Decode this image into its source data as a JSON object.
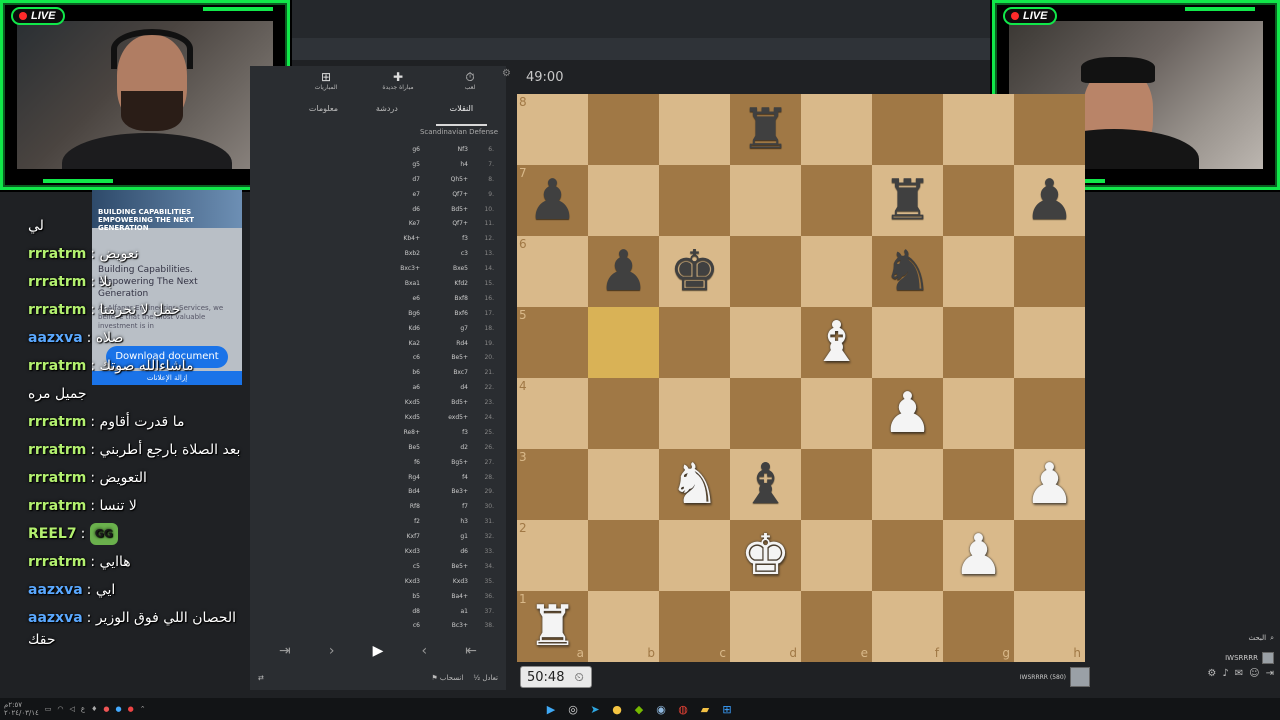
{
  "overlay": {
    "live_label": "LIVE",
    "colors": {
      "frame": "#11e84a",
      "live_dot": "#ff2b2b"
    }
  },
  "chat": [
    {
      "user": "",
      "message": "لي",
      "color": "#ffffff"
    },
    {
      "user": "rrratrm",
      "message": "نعويض",
      "color": "#b3f06f"
    },
    {
      "user": "rrratrm",
      "message": "بلا",
      "color": "#b3f06f"
    },
    {
      "user": "rrratrm",
      "message": "خمل لا نحرمنا",
      "color": "#b3f06f"
    },
    {
      "user": "aazxva",
      "message": "صلاه",
      "color": "#5aa8ff"
    },
    {
      "user": "rrratrm",
      "message": "ماشاءالله صوتك",
      "color": "#b3f06f"
    },
    {
      "user": "",
      "message": "جميل مره",
      "color": "#ffffff"
    },
    {
      "user": "rrratrm",
      "message": "ما قدرت أقاوم",
      "color": "#b3f06f"
    },
    {
      "user": "rrratrm",
      "message": "بعد الصلاة بارجع أطربني",
      "color": "#b3f06f",
      "wrap": true
    },
    {
      "user": "rrratrm",
      "message": "التعويض",
      "color": "#b3f06f"
    },
    {
      "user": "rrratrm",
      "message": "لا تنسا",
      "color": "#b3f06f"
    },
    {
      "user": "REEL7",
      "message": "",
      "emote": "GG",
      "color": "#b3f06f"
    },
    {
      "user": "rrratrm",
      "message": "هاايي",
      "color": "#b3f06f"
    },
    {
      "user": "aazxva",
      "message": "ايي",
      "color": "#5aa8ff"
    },
    {
      "user": "aazxva",
      "message": "الحصان اللي فوق الوزير حقك",
      "color": "#5aa8ff",
      "wrap": true
    }
  ],
  "ad": {
    "banner": "BUILDING CAPABILITIES EMPOWERING THE NEXT GENERATION",
    "title": "Building Capabilities. Empowering The Next Generation",
    "body": "At Alfanar Engineering Services, we believe that the most valuable investment is in",
    "button": "Download document",
    "footer": "إزالة الإعلانات"
  },
  "panel": {
    "tabs": [
      {
        "icon": "⏱",
        "label": "لعب"
      },
      {
        "icon": "✚",
        "label": "مباراة جديدة"
      },
      {
        "icon": "⊞",
        "label": "المباريات"
      }
    ],
    "subtabs": [
      "النقلات",
      "دردشة",
      "معلومات"
    ],
    "opening": "Scandinavian Defense",
    "moves": [
      {
        "n": "6.",
        "w": "Nf3",
        "b": "g6",
        "t": ""
      },
      {
        "n": "7.",
        "w": "h4",
        "b": "g5",
        "t": ""
      },
      {
        "n": "8.",
        "w": "Qh5+",
        "b": "d7",
        "t": ""
      },
      {
        "n": "9.",
        "w": "Qf7+",
        "b": "e7",
        "t": ""
      },
      {
        "n": "10.",
        "w": "Bd5+",
        "b": "d6",
        "t": ""
      },
      {
        "n": "11.",
        "w": "Qf7+",
        "b": "Ke7",
        "t": ""
      },
      {
        "n": "12.",
        "w": "f3",
        "b": "Kb4+",
        "t": ""
      },
      {
        "n": "13.",
        "w": "c3",
        "b": "Bxb2",
        "t": ""
      },
      {
        "n": "14.",
        "w": "Bxe5",
        "b": "Bxc3+",
        "t": ""
      },
      {
        "n": "15.",
        "w": "Kfd2",
        "b": "Bxa1",
        "t": ""
      },
      {
        "n": "16.",
        "w": "Bxf8",
        "b": "e6",
        "t": ""
      },
      {
        "n": "17.",
        "w": "Bxf6",
        "b": "Bg6",
        "t": ""
      },
      {
        "n": "18.",
        "w": "g7",
        "b": "Kd6",
        "t": ""
      },
      {
        "n": "19.",
        "w": "Rd4",
        "b": "Ka2",
        "t": ""
      },
      {
        "n": "20.",
        "w": "Be5+",
        "b": "c6",
        "t": ""
      },
      {
        "n": "21.",
        "w": "Bxc7",
        "b": "b6",
        "t": ""
      },
      {
        "n": "22.",
        "w": "d4",
        "b": "a6",
        "t": ""
      },
      {
        "n": "23.",
        "w": "Bd5+",
        "b": "Kxd5",
        "t": ""
      },
      {
        "n": "24.",
        "w": "exd5+",
        "b": "Kxd5",
        "t": ""
      },
      {
        "n": "25.",
        "w": "f3",
        "b": "Re8+",
        "t": ""
      },
      {
        "n": "26.",
        "w": "d2",
        "b": "Be5",
        "t": ""
      },
      {
        "n": "27.",
        "w": "Bg5+",
        "b": "f6",
        "t": ""
      },
      {
        "n": "28.",
        "w": "f4",
        "b": "Rg4",
        "t": ""
      },
      {
        "n": "29.",
        "w": "Be3+",
        "b": "Bd4",
        "t": ""
      },
      {
        "n": "30.",
        "w": "f7",
        "b": "Rf8",
        "t": ""
      },
      {
        "n": "31.",
        "w": "h3",
        "b": "f2",
        "t": ""
      },
      {
        "n": "32.",
        "w": "g1",
        "b": "Kxf7",
        "t": ""
      },
      {
        "n": "33.",
        "w": "d6",
        "b": "Kxd3",
        "t": ""
      },
      {
        "n": "34.",
        "w": "Be5+",
        "b": "c5",
        "t": ""
      },
      {
        "n": "35.",
        "w": "Kxd3",
        "b": "Kxd3",
        "t": ""
      },
      {
        "n": "36.",
        "w": "Ba4+",
        "b": "b5",
        "t": ""
      },
      {
        "n": "37.",
        "w": "a1",
        "b": "d8",
        "t": ""
      },
      {
        "n": "38.",
        "w": "Bc3+",
        "b": "c6",
        "t": ""
      }
    ],
    "draw_label": "½ تعادل",
    "resign_label": "انسحاب"
  },
  "board": {
    "timer_top": "49:00",
    "timer_bottom": "50:48",
    "ranks": [
      "8",
      "7",
      "6",
      "5",
      "4",
      "3",
      "2",
      "1"
    ],
    "files": [
      "a",
      "b",
      "c",
      "d",
      "e",
      "f",
      "g",
      "h"
    ],
    "pieces": {
      "d8": "bR",
      "a7": "bP",
      "f7": "bR",
      "h7": "bP",
      "b6": "bP",
      "c6": "bK",
      "f6": "bN",
      "e5": "wB",
      "f4": "wP",
      "c3": "wN",
      "d3": "bB",
      "h3": "wP",
      "d2": "wK",
      "g2": "wP",
      "a1": "wR"
    },
    "highlight": [
      "b5"
    ],
    "player_bottom": "IWSRRRR (580)"
  },
  "sidebar": {
    "search_label": "البحث",
    "user": "IWSRRRR"
  },
  "taskbar": {
    "clock": "٢:٥٧م",
    "date": "٢٠٢٤/٠٣/١٤"
  }
}
